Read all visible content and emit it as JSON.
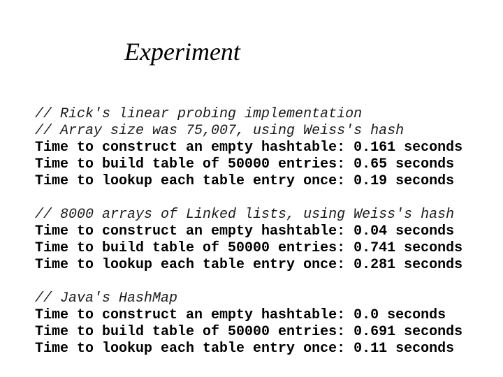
{
  "slide": {
    "title": "Experiment"
  },
  "experiments": [
    {
      "comments": [
        "// Rick's linear probing implementation",
        "// Array size was 75,007, using Weiss's hash"
      ],
      "timings": [
        {
          "label": "Time to construct an empty hashtable:",
          "value": "0.161",
          "unit": "seconds"
        },
        {
          "label": "Time to build table of 50000 entries:",
          "value": "0.65",
          "unit": "seconds"
        },
        {
          "label": "Time to lookup each table entry once:",
          "value": "0.19",
          "unit": "seconds"
        }
      ]
    },
    {
      "comments": [
        "// 8000 arrays of Linked lists, using Weiss's hash"
      ],
      "timings": [
        {
          "label": "Time to construct an empty hashtable:",
          "value": "0.04",
          "unit": "seconds"
        },
        {
          "label": "Time to build table of 50000 entries:",
          "value": "0.741",
          "unit": "seconds"
        },
        {
          "label": "Time to lookup each table entry once:",
          "value": "0.281",
          "unit": "seconds"
        }
      ]
    },
    {
      "comments": [
        "// Java's HashMap"
      ],
      "timings": [
        {
          "label": "Time to construct an empty hashtable:",
          "value": "0.0",
          "unit": "seconds"
        },
        {
          "label": "Time to build table of 50000 entries:",
          "value": "0.691",
          "unit": "seconds"
        },
        {
          "label": "Time to lookup each table entry once:",
          "value": "0.11",
          "unit": "seconds"
        }
      ]
    }
  ]
}
